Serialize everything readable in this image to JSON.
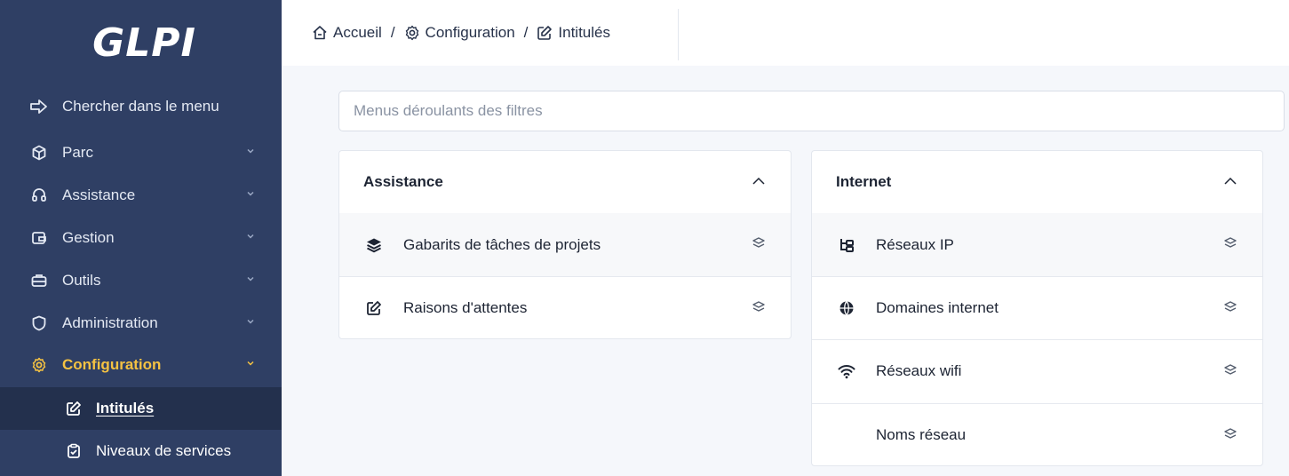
{
  "app": {
    "logo_text": "GLPI"
  },
  "sidebar": {
    "search_label": "Chercher dans le menu",
    "items": [
      {
        "label": "Parc",
        "icon": "box-icon"
      },
      {
        "label": "Assistance",
        "icon": "headset-icon"
      },
      {
        "label": "Gestion",
        "icon": "wallet-icon"
      },
      {
        "label": "Outils",
        "icon": "briefcase-icon"
      },
      {
        "label": "Administration",
        "icon": "shield-icon"
      },
      {
        "label": "Configuration",
        "icon": "gear-icon",
        "active": true
      }
    ],
    "sub_items": [
      {
        "label": "Intitulés",
        "icon": "edit-icon",
        "current": true
      },
      {
        "label": "Niveaux de services",
        "icon": "clipboard-check-icon"
      }
    ],
    "colors": {
      "background": "#2f3f64",
      "active": "#f5c242",
      "current_bg": "#23304d"
    }
  },
  "breadcrumb": {
    "home": "Accueil",
    "separator": "/",
    "config": "Configuration",
    "current": "Intitulés"
  },
  "filter": {
    "placeholder": "Menus déroulants des filtres",
    "value": ""
  },
  "cards": {
    "assistance": {
      "title": "Assistance",
      "rows": [
        {
          "label": "Gabarits de tâches de projets",
          "icon": "layers-stack-icon"
        },
        {
          "label": "Raisons d'attentes",
          "icon": "edit-icon"
        }
      ]
    },
    "internet": {
      "title": "Internet",
      "rows": [
        {
          "label": "Réseaux IP",
          "icon": "network-tree-icon"
        },
        {
          "label": "Domaines internet",
          "icon": "globe-icon"
        },
        {
          "label": "Réseaux wifi",
          "icon": "wifi-icon"
        },
        {
          "label": "Noms réseau",
          "icon": ""
        }
      ]
    }
  }
}
